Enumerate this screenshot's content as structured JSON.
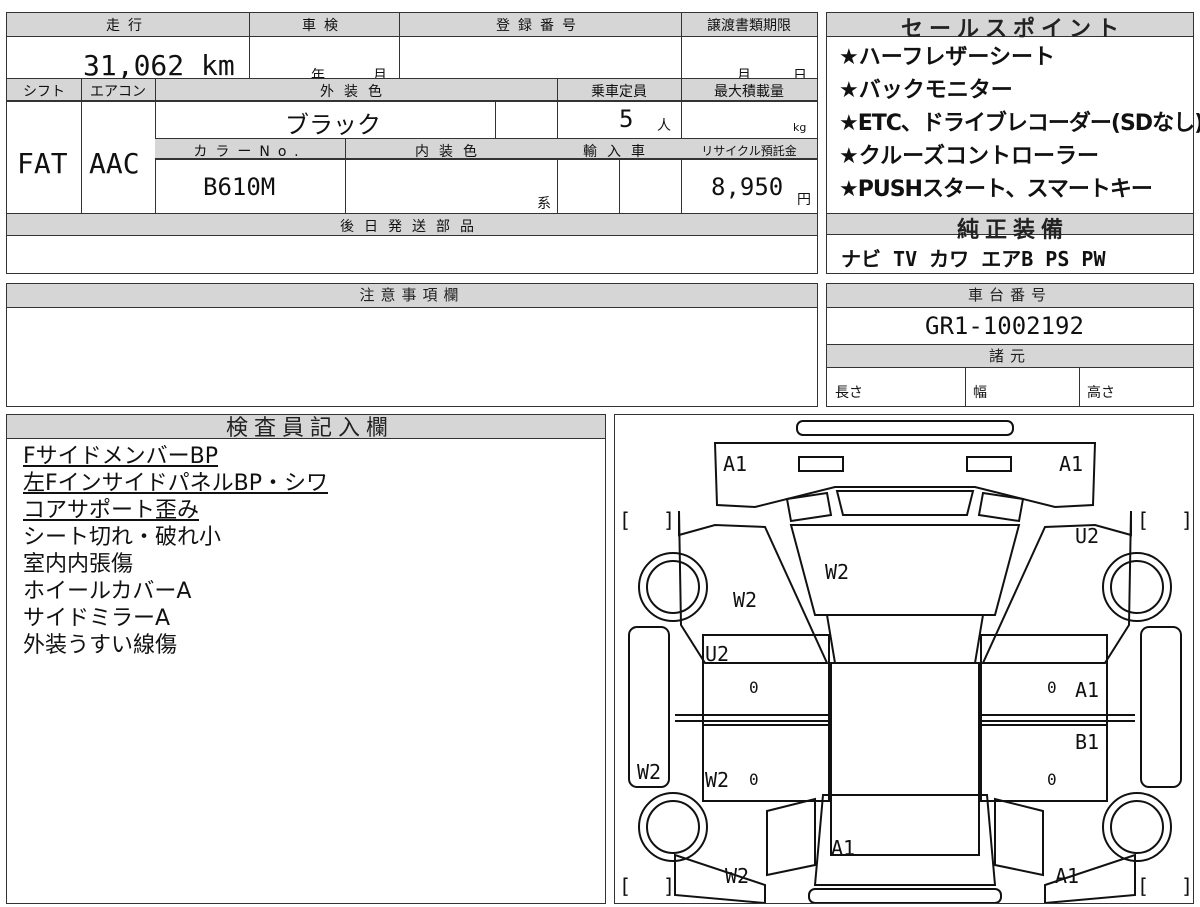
{
  "top_table": {
    "mileage": {
      "header": "走行",
      "value": "31,062 km"
    },
    "inspection": {
      "header": "車検",
      "year_unit": "年",
      "month_unit": "月"
    },
    "registration": {
      "header": "登録番号",
      "value": ""
    },
    "transfer_deadline": {
      "header": "譲渡書類期限",
      "month_unit": "月",
      "day_unit": "日"
    },
    "shift": {
      "header": "シフト",
      "value": "FAT"
    },
    "aircon": {
      "header": "エアコン",
      "value": "AAC"
    },
    "exterior_color": {
      "header": "外装色",
      "value": "ブラック"
    },
    "capacity": {
      "header": "乗車定員",
      "value": "5",
      "unit": "人"
    },
    "max_load": {
      "header": "最大積載量",
      "unit": "kg"
    },
    "color_no": {
      "header": "カラーNo.",
      "value": "B610M"
    },
    "interior_color": {
      "header": "内装色",
      "suffix": "系"
    },
    "import": {
      "header": "輸入車"
    },
    "recycle": {
      "header": "リサイクル預託金",
      "value": "8,950",
      "unit": "円"
    },
    "later_parts": {
      "header": "後日発送部品"
    }
  },
  "sales_points": {
    "header": "セールスポイント",
    "items": [
      "★ハーフレザーシート",
      "★バックモニター",
      "★ETC、ドライブレコーダー(SDなし)",
      "★クルーズコントローラー",
      "★PUSHスタート、スマートキー"
    ]
  },
  "genuine_equipment": {
    "header": "純正装備",
    "value": "ナビ TV カワ エアB PS PW"
  },
  "notes": {
    "header": "注意事項欄"
  },
  "chassis": {
    "header": "車台番号",
    "value": "GR1-1002192"
  },
  "specs": {
    "header": "諸元",
    "length": "長さ",
    "width": "幅",
    "height": "高さ"
  },
  "inspector": {
    "header": "検査員記入欄",
    "items": [
      {
        "text": "FサイドメンバーBP",
        "underline": true
      },
      {
        "text": "左FインサイドパネルBP・シワ",
        "underline": true
      },
      {
        "text": "コアサポート歪み",
        "underline": true
      },
      {
        "text": "シート切れ・破れ小",
        "underline": false
      },
      {
        "text": "室内内張傷",
        "underline": false
      },
      {
        "text": "ホイールカバーA",
        "underline": false
      },
      {
        "text": "サイドミラーA",
        "underline": false
      },
      {
        "text": "外装うすい線傷",
        "underline": false
      }
    ]
  },
  "diagram": {
    "codes": {
      "front_left": "A1",
      "front_right": "A1",
      "windshield": "W2",
      "left_glass": "W2",
      "right_fender": "U2",
      "left_front_door": "U2",
      "left_front_door_num": "0",
      "right_front_door_num": "0",
      "right_front_door": "A1",
      "right_rear_door": "B1",
      "left_rear_glass": "W2",
      "left_rear_door": "W2",
      "left_rear_door_num": "0",
      "right_rear_door_num": "0",
      "left_side_glass": "W2",
      "rear_center": "A1",
      "rear_left_glass": "W2",
      "rear_right": "A1"
    },
    "brackets": {
      "open": "[",
      "close": "]"
    }
  }
}
